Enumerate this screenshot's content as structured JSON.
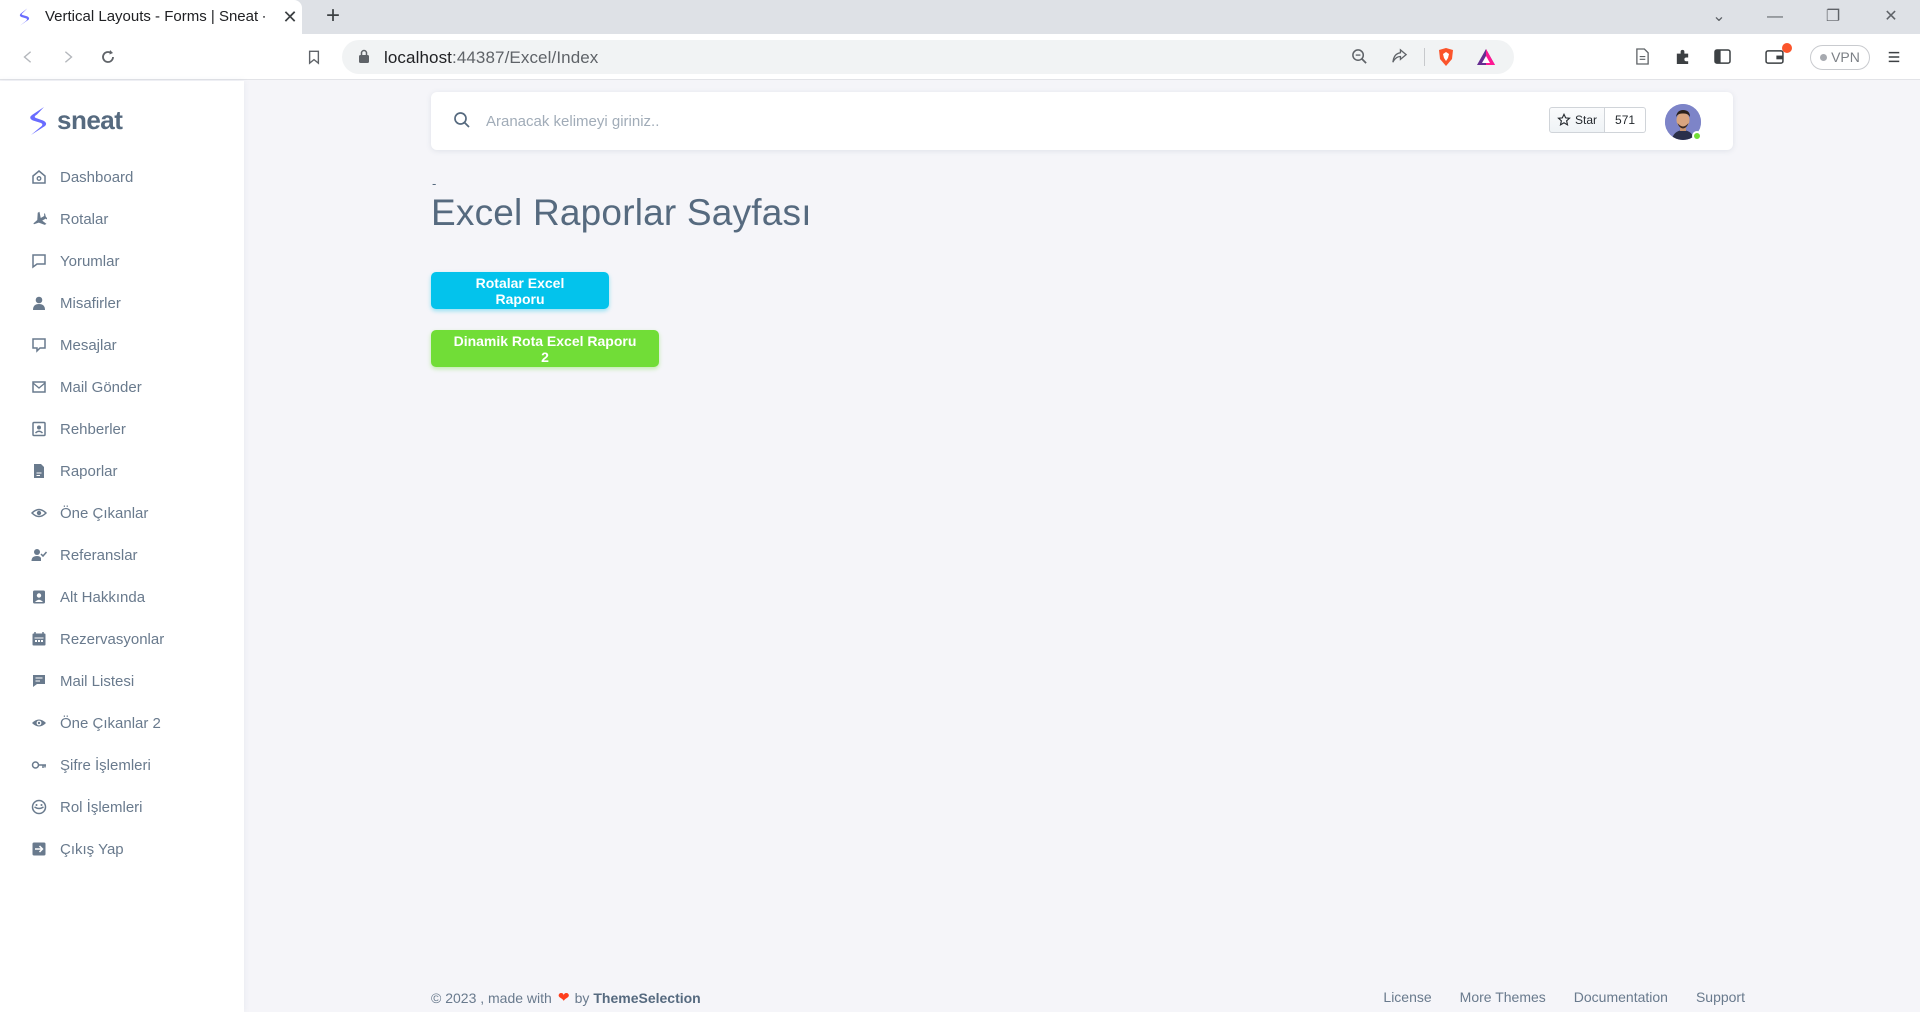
{
  "browser": {
    "tab_title": "Vertical Layouts - Forms | Sneat -",
    "tab_close": "✕",
    "new_tab": "+",
    "url_host": "localhost",
    "url_port_path": ":44387/Excel/Index",
    "vpn_label": "VPN",
    "icons": [
      "back-icon",
      "forward-icon",
      "reload-icon",
      "bookmark-icon",
      "lock-icon",
      "zoom-icon",
      "share-icon",
      "brave-shields-icon",
      "brave-rewards-icon",
      "reader-mode-icon",
      "extensions-icon",
      "sidebar-icon",
      "wallet-icon",
      "menu-icon"
    ]
  },
  "sidebar": {
    "brand": "sneat",
    "items": [
      {
        "label": "Dashboard",
        "icon": "home-icon"
      },
      {
        "label": "Rotalar",
        "icon": "plane-icon"
      },
      {
        "label": "Yorumlar",
        "icon": "comment-icon"
      },
      {
        "label": "Misafirler",
        "icon": "user-icon"
      },
      {
        "label": "Mesajlar",
        "icon": "message-icon"
      },
      {
        "label": "Mail Gönder",
        "icon": "mail-send-icon"
      },
      {
        "label": "Rehberler",
        "icon": "contact-icon"
      },
      {
        "label": "Raporlar",
        "icon": "file-icon"
      },
      {
        "label": "Öne Çıkanlar",
        "icon": "eye-icon"
      },
      {
        "label": "Referanslar",
        "icon": "user-check-icon"
      },
      {
        "label": "Alt Hakkında",
        "icon": "user-box-icon"
      },
      {
        "label": "Rezervasyonlar",
        "icon": "calendar-icon"
      },
      {
        "label": "Mail Listesi",
        "icon": "message-square-icon"
      },
      {
        "label": "Öne Çıkanlar 2",
        "icon": "eye-filled-icon"
      },
      {
        "label": "Şifre İşlemleri",
        "icon": "key-icon"
      },
      {
        "label": "Rol İşlemleri",
        "icon": "face-mask-icon"
      },
      {
        "label": "Çıkış Yap",
        "icon": "logout-icon"
      }
    ]
  },
  "navbar": {
    "search_placeholder": "Aranacak kelimeyi giriniz..",
    "star_label": "Star",
    "star_count": "571"
  },
  "main": {
    "dash": "-",
    "title": "Excel Raporlar Sayfası",
    "btn_routes": "Rotalar Excel Raporu",
    "btn_dynamic": "Dinamik Rota Excel Raporu 2"
  },
  "footer": {
    "copyright": "© 2023 , made with",
    "by": "by",
    "brand": "ThemeSelection",
    "links": [
      "License",
      "More Themes",
      "Documentation",
      "Support"
    ]
  },
  "colors": {
    "primary": "#696cff",
    "info": "#03c3ec",
    "success": "#71dd37",
    "text": "#566a7f"
  }
}
